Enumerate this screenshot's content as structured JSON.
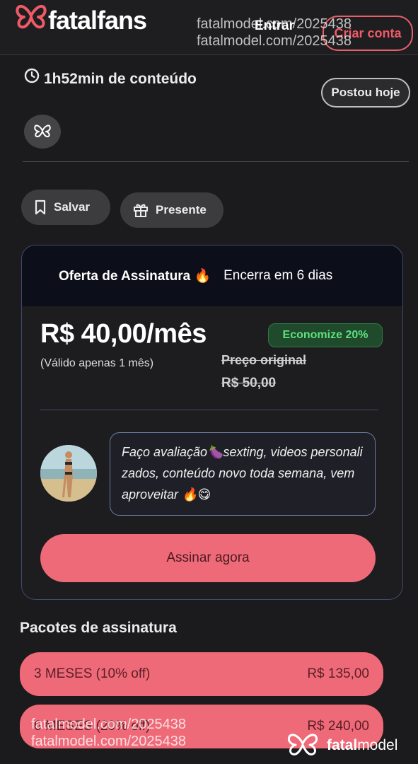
{
  "header": {
    "brand": "fatalfans",
    "login_label": "Entrar",
    "signup_label": "Criar conta",
    "watermark": "fatalmodel.com/2025438"
  },
  "content_info": {
    "duration": "1h52min de conteúdo",
    "posted_badge": "Postou hoje",
    "social_icon": "butterfly-icon"
  },
  "actions": {
    "save_label": "Salvar",
    "gift_label": "Presente"
  },
  "offer": {
    "title": "Oferta de Assinatura 🔥",
    "ends": "Encerra em 6 dias",
    "price": "R$ 40,00/mês",
    "validity": "(Válido apenas 1 mês)",
    "discount_badge": "Economize 20%",
    "original_label": "Preço original",
    "original_price": "R$ 50,00",
    "message": "Faço avaliação🍆sexting, videos personalizados, conteúdo novo toda semana, vem aproveitar 🔥😋",
    "subscribe_label": "Assinar agora"
  },
  "packages": {
    "title": "Pacotes de assinatura",
    "items": [
      {
        "label": "3 MESES (10% off)",
        "price": "R$ 135,00"
      },
      {
        "label": "6 MESES (20% off)",
        "price": "R$ 240,00"
      }
    ]
  },
  "footer_watermark": {
    "url": "fatalmodel.com/2025438",
    "brand_bold": "fatal",
    "brand_rest": "model"
  },
  "colors": {
    "accent": "#ef6a78",
    "background": "#1b1b1d",
    "success": "#5ee07e"
  }
}
